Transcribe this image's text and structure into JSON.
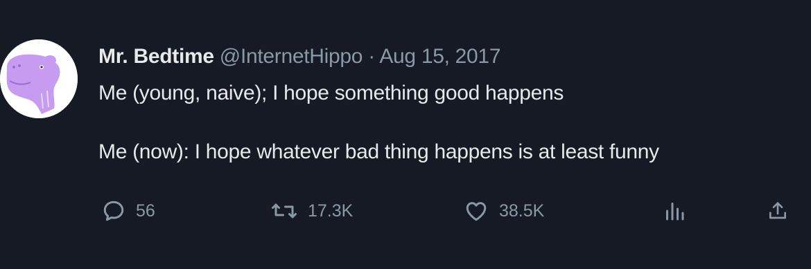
{
  "tweet": {
    "author_name": "Mr. Bedtime",
    "handle": "@InternetHippo",
    "separator": "·",
    "date": "Aug 15, 2017",
    "text_line1": "Me (young, naive); I hope something good happens",
    "text_line2": "Me (now): I hope whatever bad thing happens is at least funny",
    "avatar_icon": "hippo-avatar-icon",
    "avatar_color": "#c79bf0"
  },
  "actions": {
    "reply_count": "56",
    "retweet_count": "17.3K",
    "like_count": "38.5K"
  },
  "colors": {
    "background": "#151a24",
    "text": "#e7e9ea",
    "muted": "#8b98a5"
  }
}
